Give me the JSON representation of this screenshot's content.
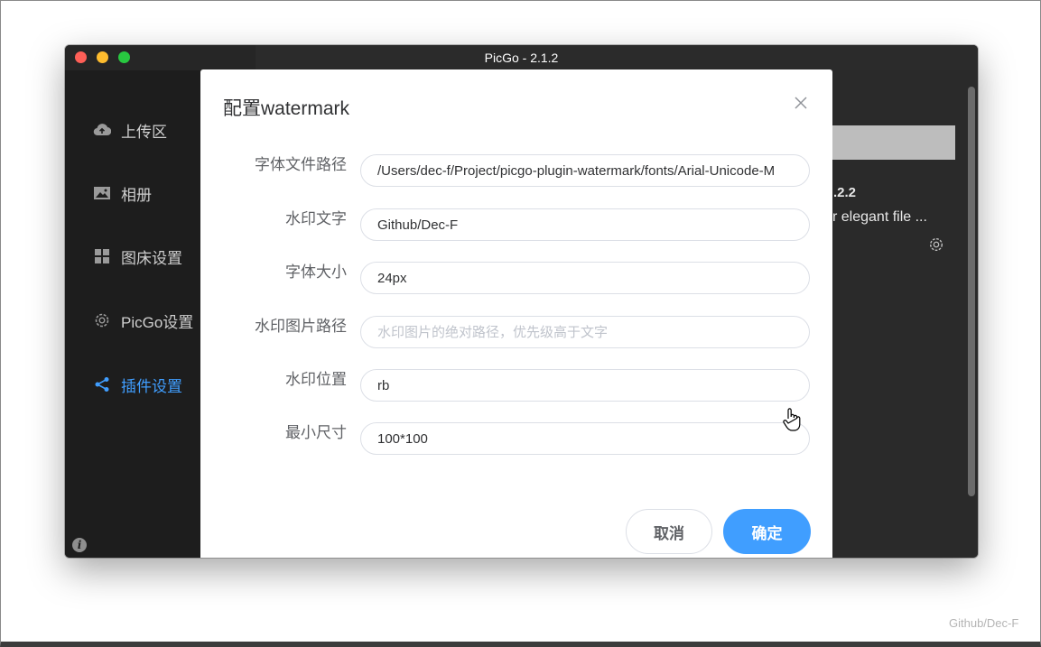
{
  "window": {
    "title": "PicGo - 2.1.2"
  },
  "sidebar": {
    "items": [
      {
        "label": "上传区",
        "icon": "cloud-upload-icon"
      },
      {
        "label": "相册",
        "icon": "image-icon"
      },
      {
        "label": "图床设置",
        "icon": "grid-icon"
      },
      {
        "label": "PicGo设置",
        "icon": "gear-icon"
      },
      {
        "label": "插件设置",
        "icon": "share-icon",
        "active": true
      }
    ]
  },
  "background_plugin": {
    "version": ".2.2",
    "description": "r elegant file ..."
  },
  "dialog": {
    "title": "配置watermark",
    "fields": [
      {
        "label": "字体文件路径",
        "value": "/Users/dec-f/Project/picgo-plugin-watermark/fonts/Arial-Unicode-M",
        "placeholder": ""
      },
      {
        "label": "水印文字",
        "value": "Github/Dec-F",
        "placeholder": ""
      },
      {
        "label": "字体大小",
        "value": "24px",
        "placeholder": ""
      },
      {
        "label": "水印图片路径",
        "value": "",
        "placeholder": "水印图片的绝对路径，优先级高于文字"
      },
      {
        "label": "水印位置",
        "value": "rb",
        "placeholder": ""
      },
      {
        "label": "最小尺寸",
        "value": "100*100",
        "placeholder": ""
      }
    ],
    "cancel_label": "取消",
    "confirm_label": "确定"
  },
  "colors": {
    "accent": "#409eff",
    "sidebar_bg": "#1d1d1d"
  },
  "corner_watermark": "Github/Dec-F"
}
